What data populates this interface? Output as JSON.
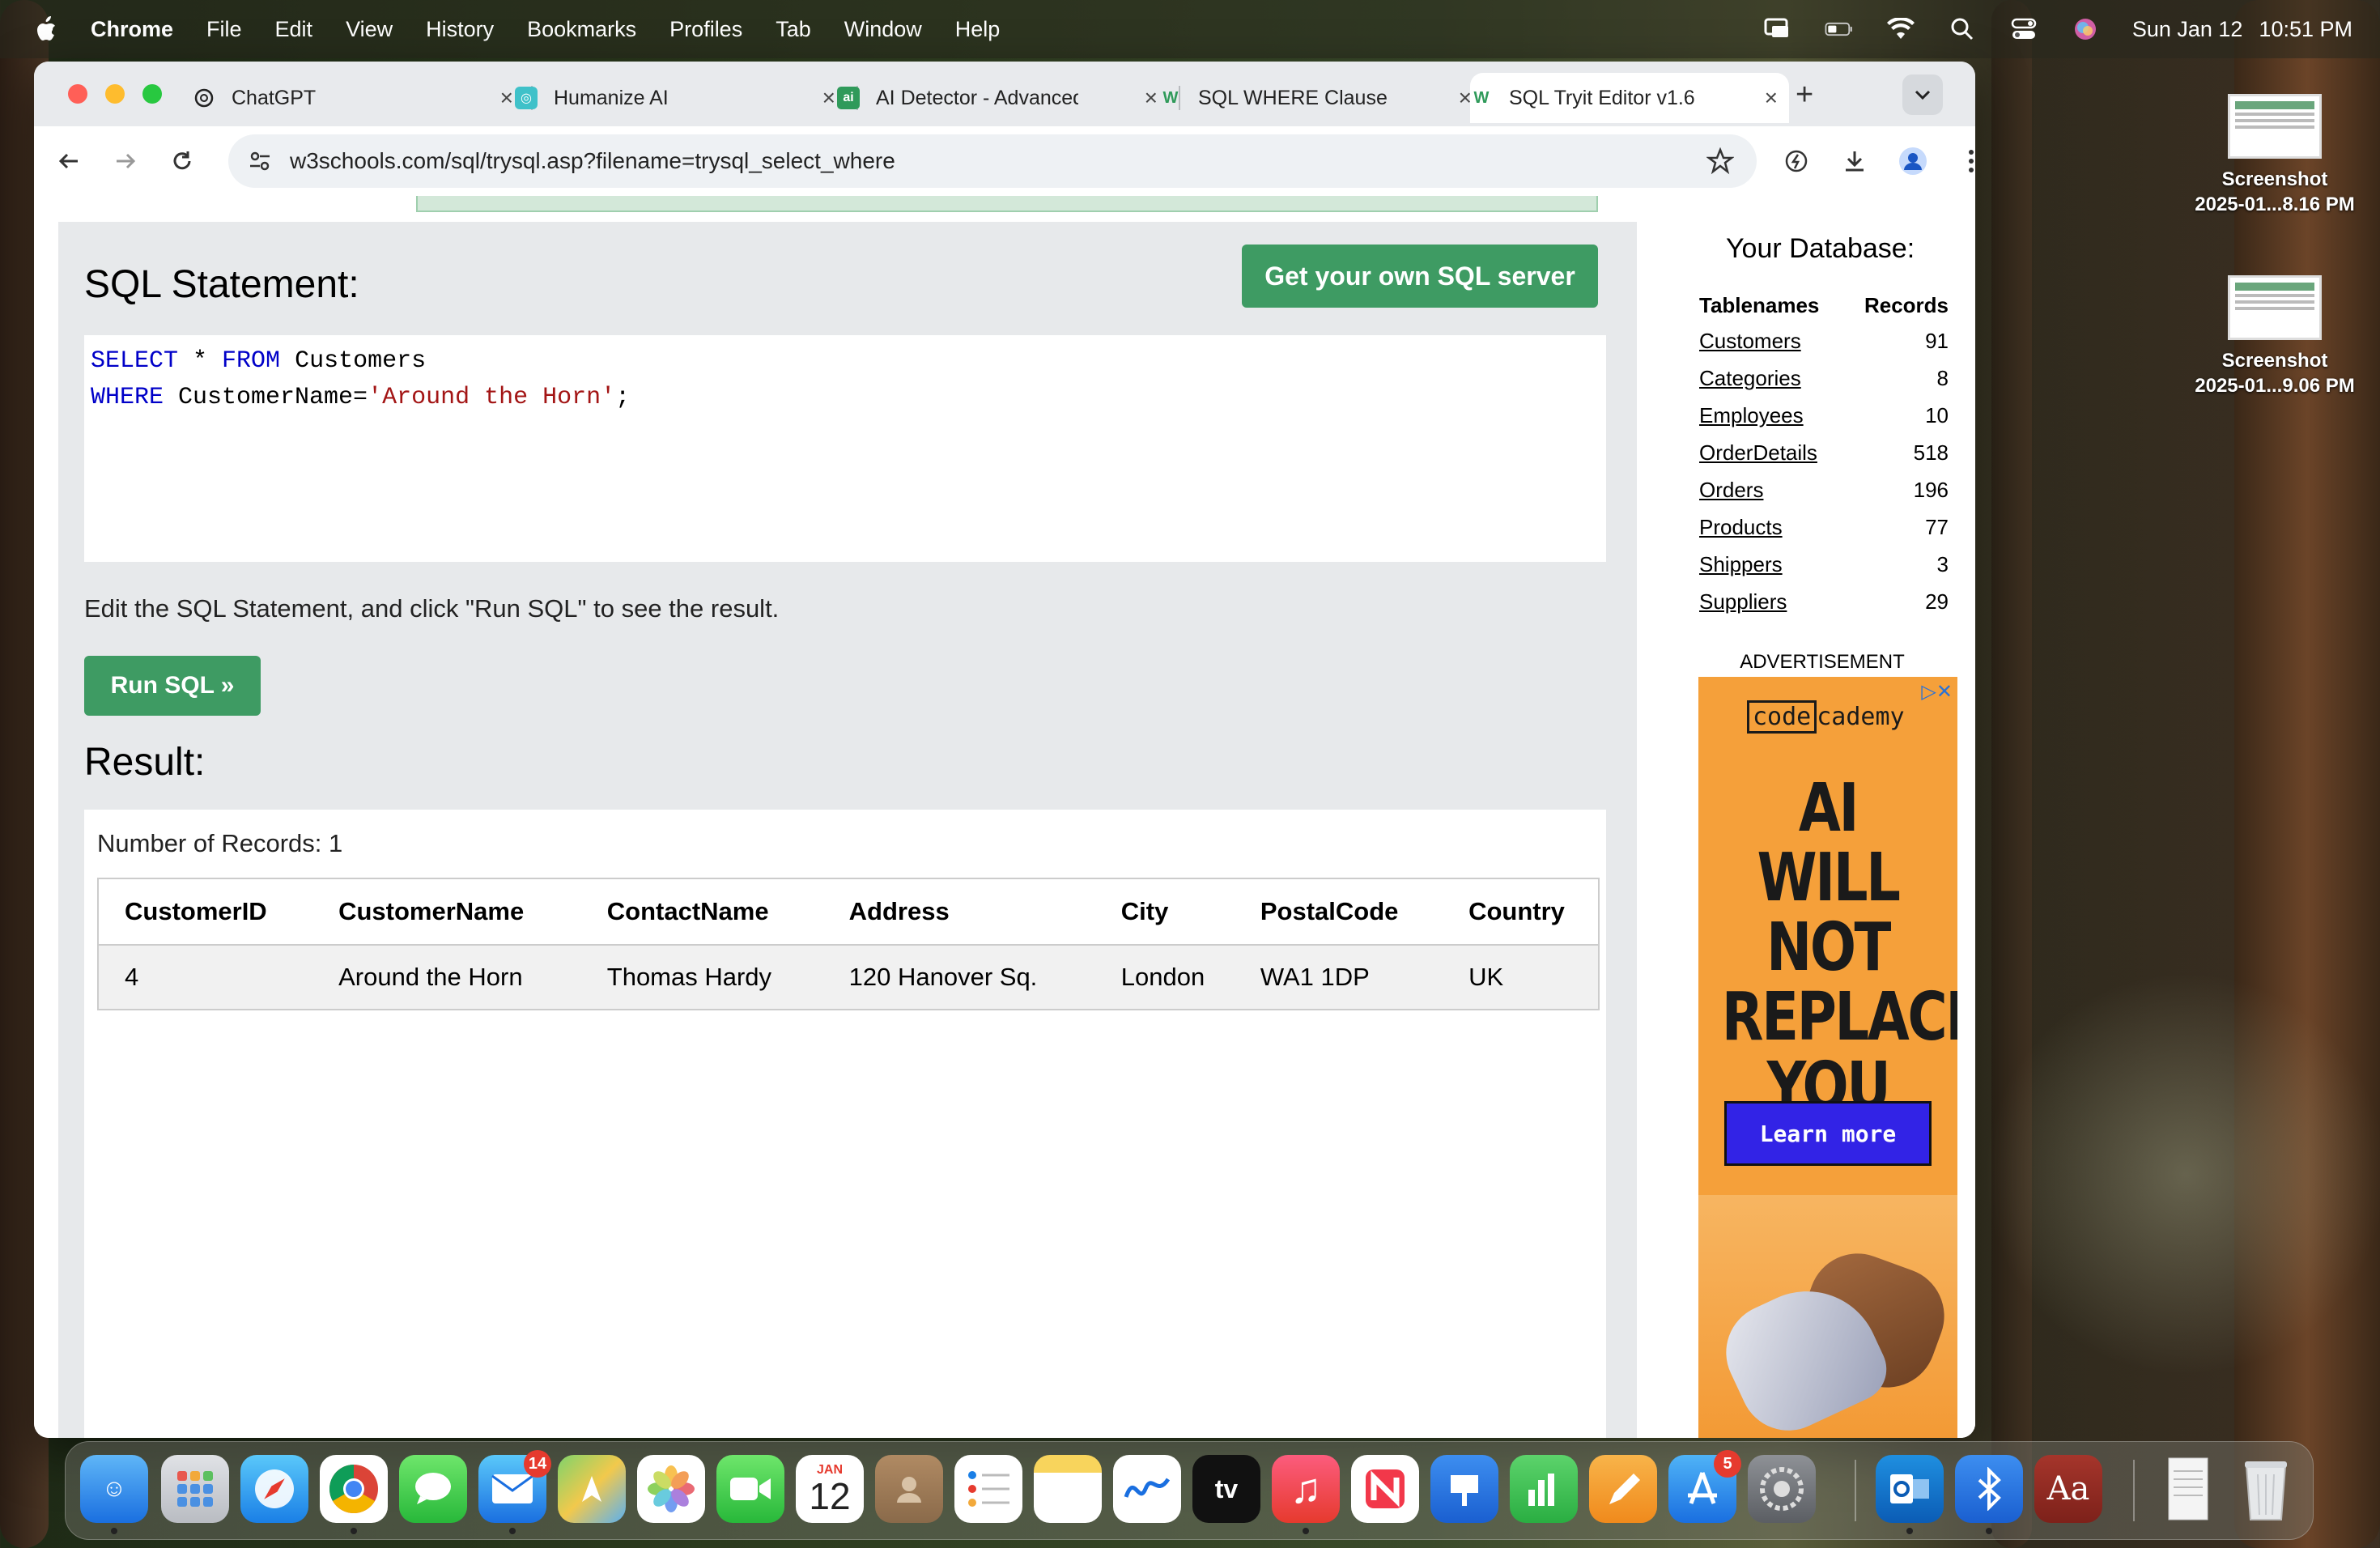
{
  "menubar": {
    "app": "Chrome",
    "items": [
      "File",
      "Edit",
      "View",
      "History",
      "Bookmarks",
      "Profiles",
      "Tab",
      "Window",
      "Help"
    ],
    "date": "Sun Jan 12",
    "time": "10:51 PM"
  },
  "tabs": [
    {
      "title": "ChatGPT",
      "icon": "chatgpt-icon"
    },
    {
      "title": "Humanize AI",
      "icon": "humanize-icon"
    },
    {
      "title": "AI Detector - Advanced",
      "icon": "ai-detector-icon"
    },
    {
      "title": "SQL WHERE Clause",
      "icon": "w3schools-icon"
    },
    {
      "title": "SQL Tryit Editor v1.6",
      "icon": "w3schools-icon"
    }
  ],
  "address": {
    "url": "w3schools.com/sql/trysql.asp?filename=trysql_select_where"
  },
  "page": {
    "sql_title": "SQL Statement:",
    "get_server": "Get your own SQL server",
    "code": {
      "l1_kw1": "SELECT",
      "l1_mid": " * ",
      "l1_kw2": "FROM",
      "l1_rest": " Customers",
      "l2_kw": "WHERE",
      "l2_mid": " CustomerName=",
      "l2_str": "'Around the Horn'",
      "l2_end": ";"
    },
    "hint": "Edit the SQL Statement, and click \"Run SQL\" to see the result.",
    "run_button": "Run SQL »",
    "result_title": "Result:",
    "num_records": "Number of Records: 1",
    "result_columns": [
      "CustomerID",
      "CustomerName",
      "ContactName",
      "Address",
      "City",
      "PostalCode",
      "Country"
    ],
    "result_rows": [
      [
        "4",
        "Around the Horn",
        "Thomas Hardy",
        "120 Hanover Sq.",
        "London",
        "WA1 1DP",
        "UK"
      ]
    ]
  },
  "database": {
    "title": "Your Database:",
    "col_tables": "Tablenames",
    "col_records": "Records",
    "tables": [
      {
        "name": "Customers",
        "records": "91"
      },
      {
        "name": "Categories",
        "records": "8"
      },
      {
        "name": "Employees",
        "records": "10"
      },
      {
        "name": "OrderDetails",
        "records": "518"
      },
      {
        "name": "Orders",
        "records": "196"
      },
      {
        "name": "Products",
        "records": "77"
      },
      {
        "name": "Shippers",
        "records": "3"
      },
      {
        "name": "Suppliers",
        "records": "29"
      }
    ]
  },
  "ad": {
    "label": "ADVERTISEMENT",
    "brand_box": "code",
    "brand_rest": "cademy",
    "headline_1": "AI WILL",
    "headline_2": "NOT",
    "headline_3": "REPLACE",
    "headline_4": "YOU",
    "cta": "Learn more"
  },
  "desktop": [
    {
      "l1": "Screenshot",
      "l2": "2025-01...8.16 PM"
    },
    {
      "l1": "Screenshot",
      "l2": "2025-01...9.06 PM"
    }
  ],
  "dock": {
    "mail_badge": "14",
    "calendar_month": "JAN",
    "calendar_day": "12",
    "appstore_badge": "5",
    "tv_label": "tv",
    "dictionary_label": "Aa"
  },
  "colors": {
    "w3_green": "#3e9b63",
    "sql_keyword": "#0000c8",
    "sql_string": "#a31515"
  }
}
